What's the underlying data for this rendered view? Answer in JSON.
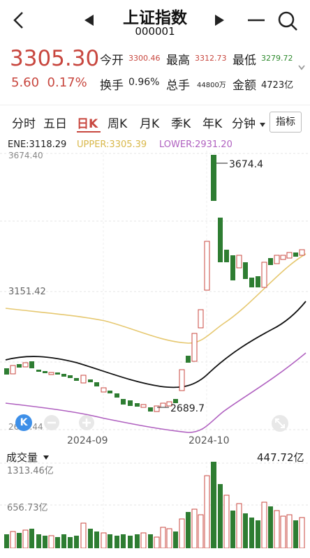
{
  "header": {
    "title": "上证指数",
    "code": "000001",
    "back_icon": "chevron-left-icon",
    "prev_icon": "triangle-left-icon",
    "next_icon": "triangle-right-icon",
    "menu_icon": "minus-icon",
    "search_icon": "search-icon"
  },
  "quote": {
    "price": "3305.30",
    "change": "5.60",
    "change_pct": "0.17%",
    "open_label": "今开",
    "open": "3300.46",
    "high_label": "最高",
    "high": "3312.73",
    "low_label": "最低",
    "low": "3279.72",
    "turnover_label": "换手",
    "turnover": "0.96%",
    "total_label": "总手",
    "total": "44800万",
    "amount_label": "金额",
    "amount": "4723亿",
    "expand_icon": "chevron-down-icon"
  },
  "tabs": [
    {
      "label": "分时"
    },
    {
      "label": "五日"
    },
    {
      "label": "日K",
      "active": true
    },
    {
      "label": "周K"
    },
    {
      "label": "月K"
    },
    {
      "label": "季K"
    },
    {
      "label": "年K"
    },
    {
      "label": "分钟"
    }
  ],
  "tab_dropdown_icon": "caret-down-icon",
  "indicator_button": "指标",
  "chart": {
    "ene_label": "ENE:3118.29",
    "upper_label": "UPPER:3305.39",
    "lower_label": "LOWER:2931.20",
    "y_top": "3674.40",
    "y_mid": "3151.42",
    "y_bottom": "2628.44",
    "max_annot": "3674.4",
    "min_annot": "2689.7",
    "x_labels": [
      "2024-09",
      "2024-10"
    ],
    "k_logo": "K",
    "zoom_out_icon": "minus-circle-icon",
    "zoom_in_icon": "plus-circle-icon",
    "fullscreen_icon": "expand-icon"
  },
  "volume": {
    "selector": "成交量",
    "selector_icon": "caret-down-icon",
    "max_label": "447.72亿",
    "y_top": "1313.46亿",
    "y_mid": "656.73亿"
  },
  "colors": {
    "up": "#c8473f",
    "down": "#2e7d32",
    "upper": "#e0c46c",
    "ene": "#111111",
    "lower": "#b061c0"
  },
  "chart_data": {
    "type": "candlestick",
    "ylim": [
      2628.44,
      3674.4
    ],
    "series": [
      {
        "name": "ENE"
      },
      {
        "name": "UPPER"
      },
      {
        "name": "LOWER"
      }
    ]
  }
}
